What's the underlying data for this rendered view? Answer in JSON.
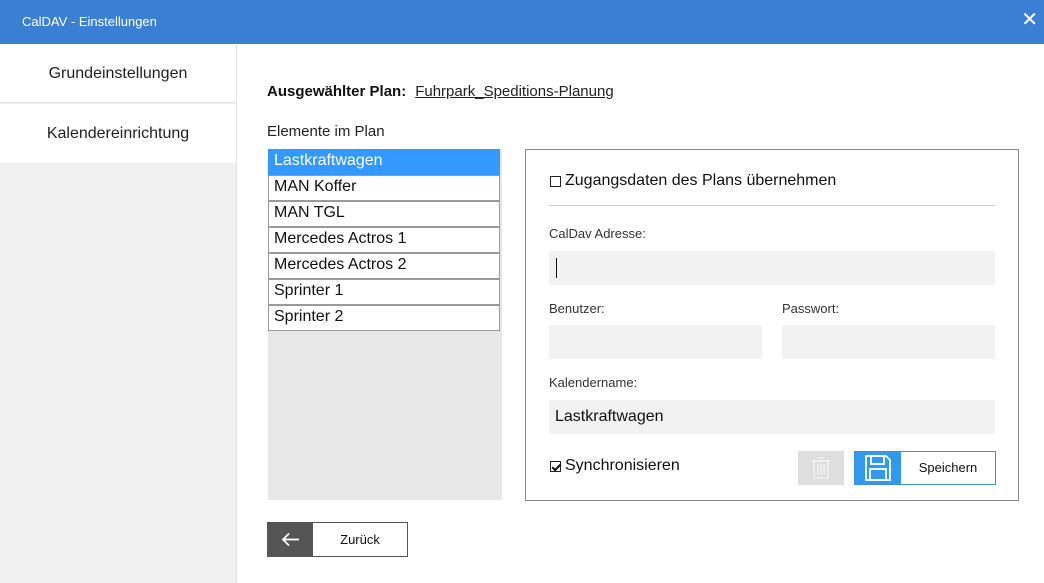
{
  "window": {
    "title": "CalDAV - Einstellungen",
    "close_glyph": "✕"
  },
  "sidebar": {
    "items": [
      {
        "label": "Grundeinstellungen"
      },
      {
        "label": "Kalendereinrichtung"
      }
    ]
  },
  "plan": {
    "label": "Ausgewählter Plan:",
    "value": "Fuhrpark_Speditions-Planung"
  },
  "elements": {
    "label": "Elemente im Plan",
    "items": [
      "Lastkraftwagen",
      "MAN Koffer",
      "MAN TGL",
      "Mercedes Actros 1",
      "Mercedes Actros 2",
      "Sprinter 1",
      "Sprinter 2"
    ],
    "selected": "Lastkraftwagen"
  },
  "form": {
    "use_plan_credentials": {
      "label": "Zugangsdaten des Plans übernehmen",
      "checked": false
    },
    "caldav_address": {
      "label": "CalDav Adresse:",
      "value": ""
    },
    "user": {
      "label": "Benutzer:",
      "value": ""
    },
    "password": {
      "label": "Passwort:",
      "value": ""
    },
    "calendar_name": {
      "label": "Kalendername:",
      "value": "Lastkraftwagen"
    },
    "synchronize": {
      "label": "Synchronisieren",
      "checked": true
    }
  },
  "buttons": {
    "delete_icon": "trash-icon",
    "save": {
      "label": "Speichern",
      "icon": "floppy-disk-icon"
    },
    "back": {
      "label": "Zurück",
      "icon": "arrow-left-icon"
    }
  },
  "colors": {
    "titlebar": "#3b7fd4",
    "selection": "#3399ff",
    "save_icon_bg": "#3399ee",
    "back_icon_bg": "#555555"
  }
}
